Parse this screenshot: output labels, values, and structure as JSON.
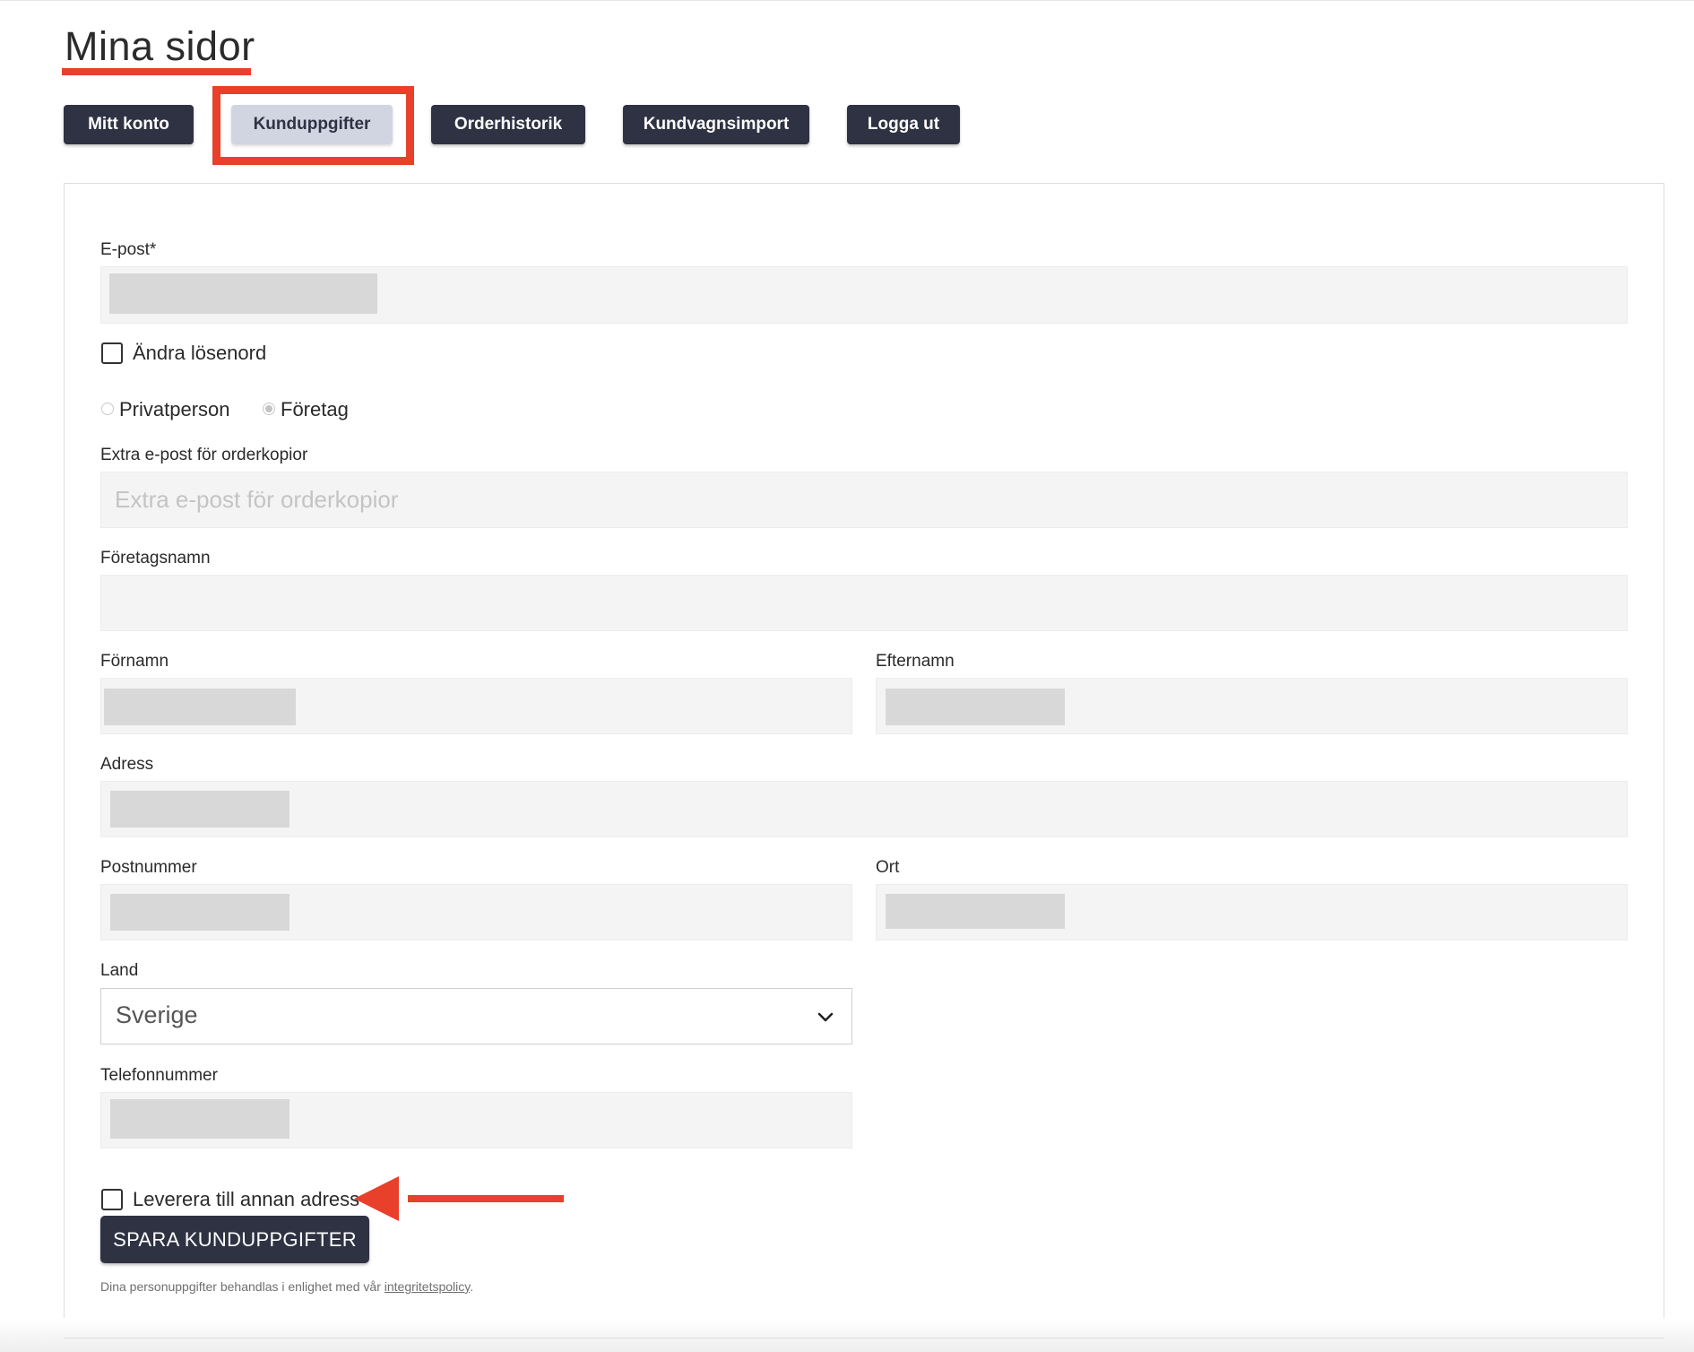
{
  "page": {
    "title": "Mina sidor"
  },
  "tabs": [
    {
      "label": "Mitt konto"
    },
    {
      "label": "Kunduppgifter"
    },
    {
      "label": "Orderhistorik"
    },
    {
      "label": "Kundvagnsimport"
    },
    {
      "label": "Logga ut"
    }
  ],
  "active_tab": "Kunduppgifter",
  "form": {
    "email_label": "E-post*",
    "change_password_label": "Ändra lösenord",
    "customer_type": {
      "options": [
        "Privatperson",
        "Företag"
      ],
      "selected": "Företag"
    },
    "extra_email_label": "Extra e-post för orderkopior",
    "extra_email_placeholder": "Extra e-post för orderkopior",
    "company_label": "Företagsnamn",
    "firstname_label": "Förnamn",
    "lastname_label": "Efternamn",
    "address_label": "Adress",
    "zip_label": "Postnummer",
    "city_label": "Ort",
    "country_label": "Land",
    "country_value": "Sverige",
    "phone_label": "Telefonnummer",
    "other_address_label": "Leverera till annan adress",
    "save_label": "SPARA KUNDUPPGIFTER",
    "privacy_text": "Dina personuppgifter behandlas i enlighet med vår ",
    "privacy_link": "integritetspolicy",
    "privacy_suffix": "."
  },
  "colors": {
    "accent_red": "#e8402b",
    "button_dark": "#2f3243",
    "tab_active_bg": "#d1d5e2",
    "field_bg": "#f4f4f4"
  }
}
